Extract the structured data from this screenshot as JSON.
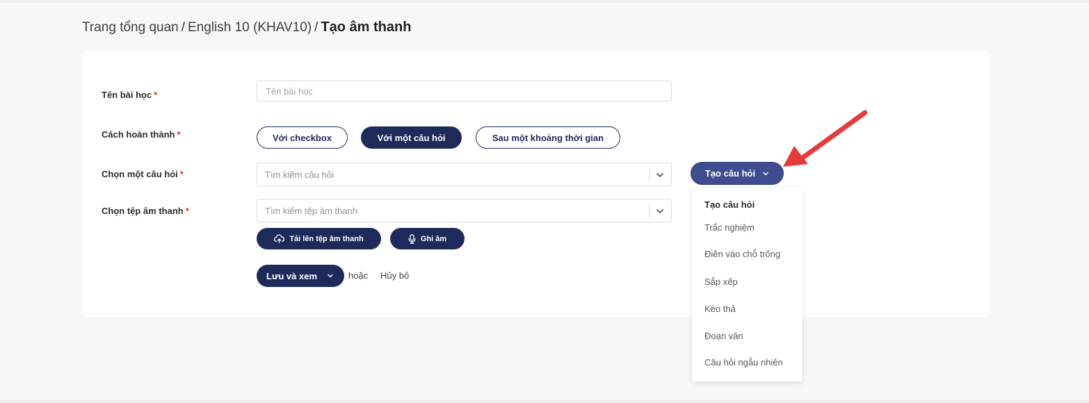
{
  "breadcrumb": {
    "home": "Trang tổng quan",
    "course": "English 10 (KHAV10)",
    "current": "Tạo âm thanh",
    "separator": "/"
  },
  "form": {
    "lesson_name": {
      "label": "Tên bài học",
      "required_mark": "*",
      "placeholder": "Tên bài học",
      "value": ""
    },
    "completion": {
      "label": "Cách hoàn thành",
      "required_mark": "*",
      "options": [
        "Với checkbox",
        "Với một câu hỏi",
        "Sau một khoảng thời gian"
      ],
      "selected": "Với một câu hỏi"
    },
    "question": {
      "label": "Chọn một câu hỏi",
      "required_mark": "*",
      "placeholder": "Tìm kiếm câu hỏi"
    },
    "audio": {
      "label": "Chọn tệp âm thanh",
      "required_mark": "*",
      "placeholder": "Tìm kiếm tệp âm thanh"
    },
    "upload_label": "Tải lên tệp âm thanh",
    "record_label": "Ghi âm",
    "save_label": "Lưu và xem",
    "or_text": "hoặc",
    "cancel_label": "Hủy bỏ"
  },
  "create_question": {
    "label": "Tạo câu hỏi",
    "menu_header": "Tạo câu hỏi",
    "menu_items": [
      "Trắc nghiệm",
      "Điền vào chỗ trống",
      "Sắp xếp",
      "Kéo thả",
      "Đoạn văn",
      "Câu hỏi ngẫu nhiên"
    ]
  },
  "icons": {
    "upload": "cloud-upload-icon",
    "record": "microphone-icon",
    "caret": "chevron-down-icon",
    "annotation": "red-arrow"
  },
  "colors": {
    "primary": "#1e2a5a",
    "primary_light": "#3f4d8f",
    "required": "#e2322b",
    "annotation_arrow": "#e63b3b"
  }
}
